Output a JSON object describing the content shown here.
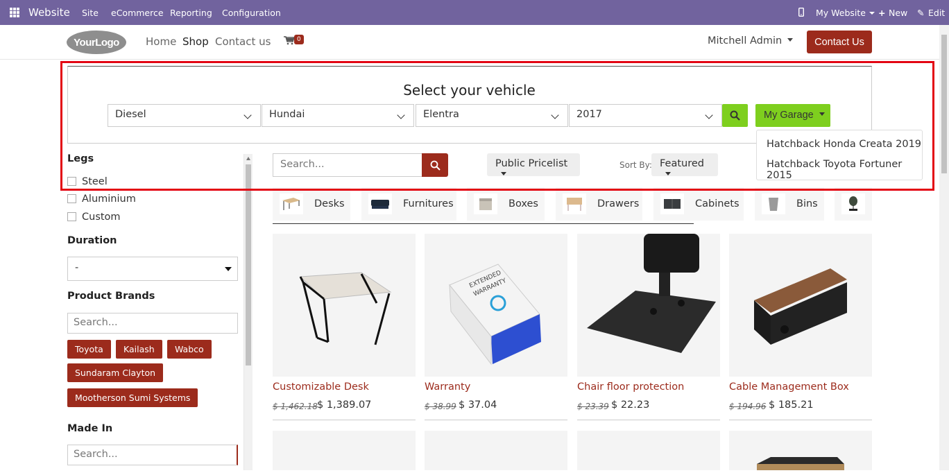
{
  "topbar": {
    "brand": "Website",
    "menu": [
      "Site",
      "eCommerce",
      "Reporting",
      "Configuration"
    ],
    "my_website": "My Website",
    "new": "New",
    "edit": "Edit",
    "bg_color": "#71639e"
  },
  "header": {
    "logo": "YourLogo",
    "nav": [
      "Home",
      "Shop",
      "Contact us"
    ],
    "cart_count": "0",
    "user": "Mitchell Admin",
    "contact_button": "Contact Us",
    "accent_color": "#9c2b1c"
  },
  "vehicle": {
    "title": "Select your vehicle",
    "fuel": "Diesel",
    "brand": "Hundai",
    "model": "Elentra",
    "year": "2017",
    "garage_button": "My Garage",
    "garage_items": [
      "Hatchback Honda Creata 2019",
      "Hatchback Toyota Fortuner 2015"
    ],
    "button_color": "#7ecf1e"
  },
  "sidebar": {
    "legs_title": "Legs",
    "legs_options": [
      "Steel",
      "Aluminium",
      "Custom"
    ],
    "duration_title": "Duration",
    "duration_value": "-",
    "brands_title": "Product Brands",
    "brands_search_placeholder": "Search...",
    "brands": [
      "Toyota",
      "Kailash",
      "Wabco",
      "Sundaram Clayton",
      "Mootherson Sumi Systems"
    ],
    "made_in_title": "Made In",
    "made_in_placeholder": "Search..."
  },
  "toolbar": {
    "search_placeholder": "Search...",
    "pricelist": "Public Pricelist",
    "sort_label": "Sort By:",
    "sort_value": "Featured"
  },
  "categories": [
    "Desks",
    "Furnitures",
    "Boxes",
    "Drawers",
    "Cabinets",
    "Bins"
  ],
  "products": [
    {
      "name": "Customizable Desk",
      "old_price": "$ 1,462.18",
      "price": "$ 1,389.07"
    },
    {
      "name": "Warranty",
      "old_price": "$ 38.99",
      "price": "$ 37.04"
    },
    {
      "name": "Chair floor protection",
      "old_price": "$ 23.39",
      "price": "$ 22.23"
    },
    {
      "name": "Cable Management Box",
      "old_price": "$ 194.96",
      "price": "$ 185.21"
    }
  ]
}
